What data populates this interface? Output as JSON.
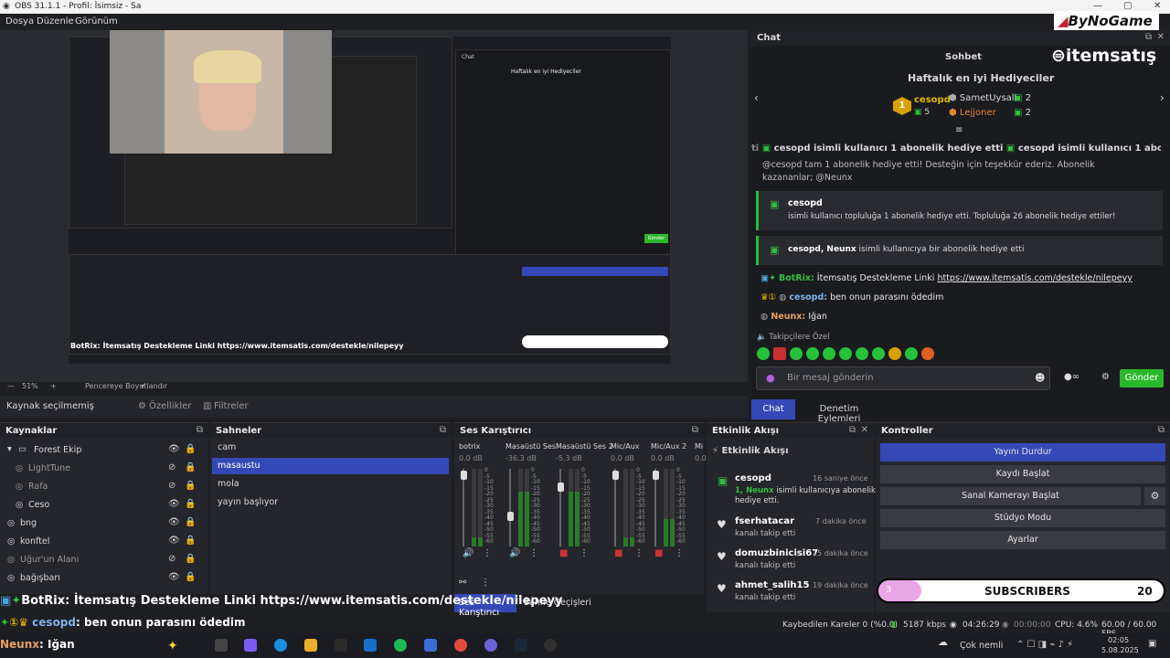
{
  "window": {
    "title": "OBS 31.1.1 - Profil: İsimsiz - Sa"
  },
  "menu": [
    "Dosya",
    "Düzenle",
    "Görünüm"
  ],
  "brand": {
    "watermark": "ByNoGame",
    "itemsatis": "itemsatış"
  },
  "preview": {
    "zoom": "51%",
    "preview_scaling": "Pencereye Boyutlandır"
  },
  "propbar": {
    "no_source": "Kaynak seçilmemiş",
    "properties": "Özellikler",
    "filters": "Filtreler"
  },
  "sources": {
    "title": "Kaynaklar",
    "items": [
      "Forest Ekip",
      "LightTune",
      "Rafa",
      "Ceso",
      "bng",
      "konftel",
      "Uğur'un Alanı",
      "bağışbarı"
    ]
  },
  "scenes": {
    "title": "Sahneler",
    "items": [
      "cam",
      "masaustu",
      "mola",
      "yayın başlıyor"
    ]
  },
  "mixer": {
    "title": "Ses Karıştırıcı",
    "channels": [
      {
        "name": "botrix",
        "db": "0.0 dB"
      },
      {
        "name": "Masaüstü Ses",
        "db": "-36.3 dB"
      },
      {
        "name": "Masaüstü Ses 2",
        "db": "-5.3 dB"
      },
      {
        "name": "Mic/Aux",
        "db": "0.0 dB"
      },
      {
        "name": "Mic/Aux 2",
        "db": "0.0 dB"
      },
      {
        "name": "Mi",
        "db": "0.0"
      }
    ],
    "ticks": [
      "0",
      "-5",
      "-10",
      "-15",
      "-20",
      "-25",
      "-30",
      "-35",
      "-40",
      "-45",
      "-50",
      "-55",
      "-60"
    ],
    "tabs": [
      "Ses Karıştırıcı",
      "Sahne Geçişleri"
    ]
  },
  "events": {
    "title": "Etkinlik Akışı",
    "subtitle": "Etkinlik Akışı",
    "items": [
      {
        "user": "cesopd",
        "time": "16 saniye önce",
        "line1": "1, Neunx",
        "line1b": " isimli kullanıcıya abonelik",
        "line2": "hediye etti."
      },
      {
        "user": "fserhatacar",
        "time": "7 dakika önce",
        "line1": "kanalı takip etti"
      },
      {
        "user": "domuzbinicisi67",
        "time": "15 dakika önce",
        "line1": "kanalı takip etti"
      },
      {
        "user": "ahmet_salih15",
        "time": "19 dakika önce",
        "line1": "kanalı takip etti"
      }
    ]
  },
  "controls": {
    "title": "Kontroller",
    "buttons": [
      "Yayını Durdur",
      "Kaydı Başlat",
      "Sanal Kamerayı Başlat",
      "Stüdyo Modu",
      "Ayarlar"
    ]
  },
  "subs": {
    "count_left": "3",
    "label": "SUBSCRIBERS",
    "count_right": "20",
    "progress": 0.15
  },
  "chat": {
    "title": "Chat",
    "sohbet": "Sohbet",
    "top_gifters": "Haftalık en iyi Hediyeciler",
    "gifters": [
      {
        "rank": "1",
        "name": "cesopd",
        "count": "5"
      },
      {
        "name": "SametUysall",
        "count": "2"
      },
      {
        "name": "Lejjoner",
        "count": "2"
      }
    ],
    "ticker": "cesopd isimli kullanıcı 1 abonelik hediye etti",
    "partial": "@cesopd tam 1 abonelik hediye etti! Desteğin için teşekkür ederiz. Abonelik",
    "partial2": "kazananlar; @Neunx",
    "gift1_user": "cesopd",
    "gift1_text": "isimli kullanıcı topluluğa 1 abonelik hediye etti. Topluluğa 26 abonelik hediye ettiler!",
    "gift2_user": "cesopd, Neunx",
    "gift2_text": " isimli kullanıcıya bir abonelik hediye etti",
    "bot_user": "BotRix:",
    "bot_text": " İtemsatış Destekleme Linki ",
    "bot_link": "https://www.itemsatis.com/destekle/nilepeyy",
    "msg1_user": "cesopd:",
    "msg1_text": " ben onun parasını ödedim",
    "msg2_user": "Neunx:",
    "msg2_text": " Iğan",
    "followers_label": "Takipçilere Özel",
    "input_placeholder": "Bir mesaj gönderin",
    "send": "Gönder",
    "tabs": [
      "Chat",
      "Denetim Eylemleri"
    ]
  },
  "overlay": {
    "line1": "BotRix: İtemsatış Destekleme Linki https://www.itemsatis.com/destekle/nilepeyy",
    "line2_user": "cesopd",
    "line2_text": ": ben onun parasını ödedim",
    "line3_user": "Neunx",
    "line3_text": ": Iğan"
  },
  "status": {
    "dropped": "Kaybedilen Kareler 0 (%0.0)",
    "kbps": "5187 kbps",
    "live": "04:26:29",
    "rec": "00:00:00",
    "cpu": "CPU: 4.6%",
    "fps": "60.00 / 60.00 FPS"
  },
  "taskbar": {
    "weather": "Çok nemli",
    "time": "02:05",
    "date": "5.08.2025"
  }
}
